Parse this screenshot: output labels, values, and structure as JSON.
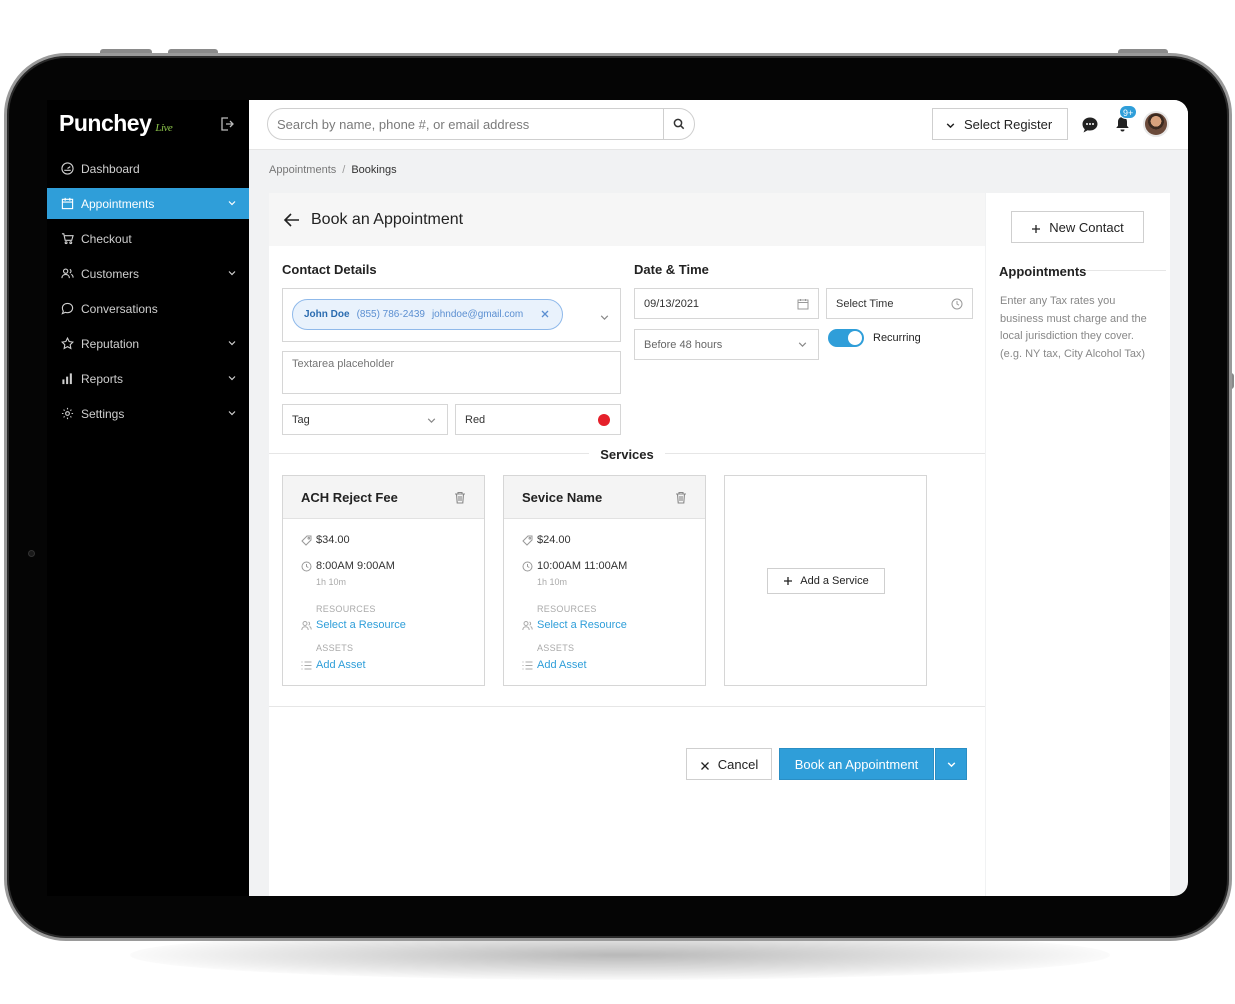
{
  "brand": {
    "name": "Punchey",
    "tag": "Live"
  },
  "sidebar": {
    "items": [
      {
        "label": "Dashboard",
        "icon": "dashboard-icon",
        "active": false,
        "chevron": false
      },
      {
        "label": "Appointments",
        "icon": "calendar-icon",
        "active": true,
        "chevron": true
      },
      {
        "label": "Checkout",
        "icon": "cart-icon",
        "active": false,
        "chevron": false
      },
      {
        "label": "Customers",
        "icon": "users-icon",
        "active": false,
        "chevron": true
      },
      {
        "label": "Conversations",
        "icon": "chat-icon",
        "active": false,
        "chevron": false
      },
      {
        "label": "Reputation",
        "icon": "star-icon",
        "active": false,
        "chevron": true
      },
      {
        "label": "Reports",
        "icon": "bar-chart-icon",
        "active": false,
        "chevron": true
      },
      {
        "label": "Settings",
        "icon": "gear-icon",
        "active": false,
        "chevron": true
      }
    ]
  },
  "topbar": {
    "search_placeholder": "Search by name, phone #, or email address",
    "register_label": "Select Register",
    "notification_count": "9+"
  },
  "breadcrumb": {
    "parent": "Appointments",
    "separator": "/",
    "current": "Bookings"
  },
  "page": {
    "title": "Book an Appointment",
    "contact_details_label": "Contact Details",
    "contact": {
      "name": "John Doe",
      "phone": "(855) 786-2439",
      "email": "johndoe@gmail.com"
    },
    "textarea_placeholder": "Textarea placeholder",
    "tag_label": "Tag",
    "color_value": "Red",
    "color_hex": "#e5202a",
    "date_time_label": "Date & Time",
    "date_value": "09/13/2021",
    "time_placeholder": "Select Time",
    "reminder_value": "Before 48 hours",
    "recurring_label": "Recurring",
    "recurring_on": true,
    "services_label": "Services",
    "services": [
      {
        "name": "ACH Reject Fee",
        "price": "$34.00",
        "time": "8:00AM 9:00AM",
        "duration": "1h 10m",
        "resources_label": "RESOURCES",
        "resource_link": "Select a Resource",
        "assets_label": "ASSETS",
        "asset_link": "Add Asset"
      },
      {
        "name": "Sevice Name",
        "price": "$24.00",
        "time": "10:00AM 11:00AM",
        "duration": "1h 10m",
        "resources_label": "RESOURCES",
        "resource_link": "Select a Resource",
        "assets_label": "ASSETS",
        "asset_link": "Add Asset"
      }
    ],
    "add_service_label": "Add a Service",
    "cancel_label": "Cancel",
    "book_label": "Book an Appointment"
  },
  "right_panel": {
    "new_contact_label": "New Contact",
    "title": "Appointments",
    "description": "Enter any Tax rates you business must charge and the local jurisdiction they cover. (e.g. NY tax, City Alcohol Tax)"
  },
  "colors": {
    "accent": "#2f9ed9",
    "sidebar_bg": "#000000",
    "content_bg": "#f1f2f3"
  }
}
